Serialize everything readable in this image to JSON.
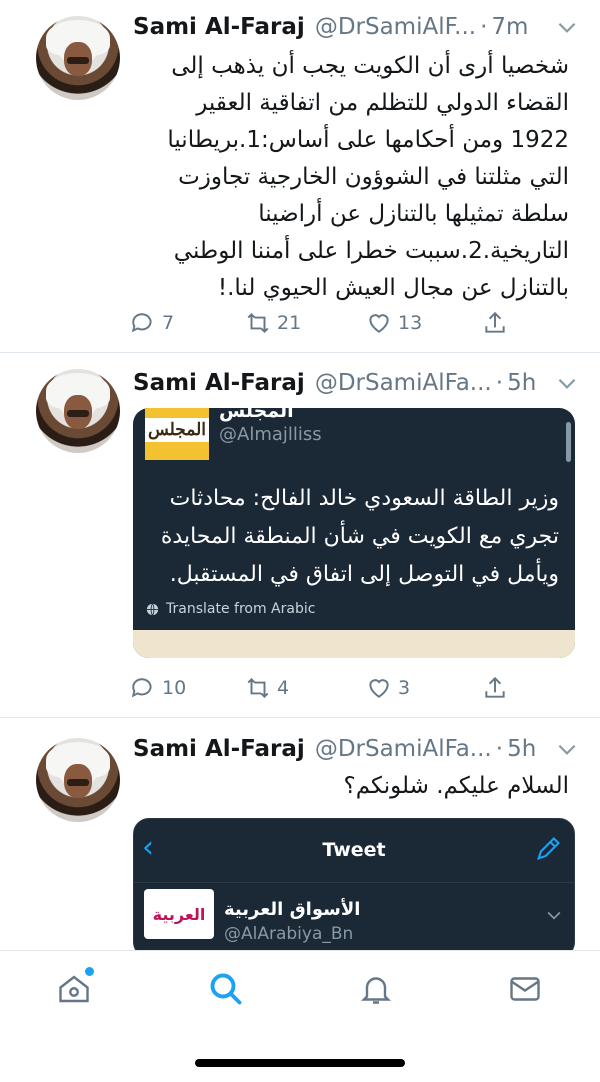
{
  "tweets": [
    {
      "name": "Sami Al-Faraj",
      "handle": "@DrSamiAlF...",
      "time": "7m",
      "text": "شخصيا أرى أن الكويت يجب أن يذهب إلى القضاء الدولي للتظلم من اتفاقية العقير 1922 ومن أحكامها على أساس:1.بريطانيا التي مثلتنا في الشوؤون الخارجية تجاوزت سلطة تمثيلها بالتنازل عن أراضينا التاريخية.2.سببت خطرا على أمننا الوطني  بالتنازل عن مجال العيش الحيوي لنا.!",
      "replies": "7",
      "retweets": "21",
      "likes": "13"
    },
    {
      "name": "Sami Al-Faraj",
      "handle": "@DrSamiAlFa...",
      "time": "5h",
      "replies": "10",
      "retweets": "4",
      "likes": "3",
      "card": {
        "logo_text": "المجلس",
        "account_name": "المجلس",
        "account_handle": "@Almajlliss",
        "text": "وزير الطاقة السعودي خالد الفالح: محادثات تجري مع الكويت في شأن المنطقة المحايدة ويأمل في التوصل إلى اتفاق في المستقبل.",
        "translate_label": "Translate from Arabic"
      }
    },
    {
      "name": "Sami Al-Faraj",
      "handle": "@DrSamiAlFa...",
      "time": "5h",
      "text": "السلام عليكم. شلونكم؟",
      "card": {
        "title": "Tweet",
        "logo_text": "العربية",
        "account_name": "الأسواق العربية",
        "account_handle": "@AlArabiya_Bn"
      }
    }
  ],
  "tabbar": {
    "items": [
      "home-icon",
      "search-icon",
      "notifications-icon",
      "messages-icon"
    ],
    "active": "search-icon"
  },
  "colors": {
    "accent": "#1da1f2",
    "secondary_text": "#657786",
    "card_background": "#1b2836"
  }
}
